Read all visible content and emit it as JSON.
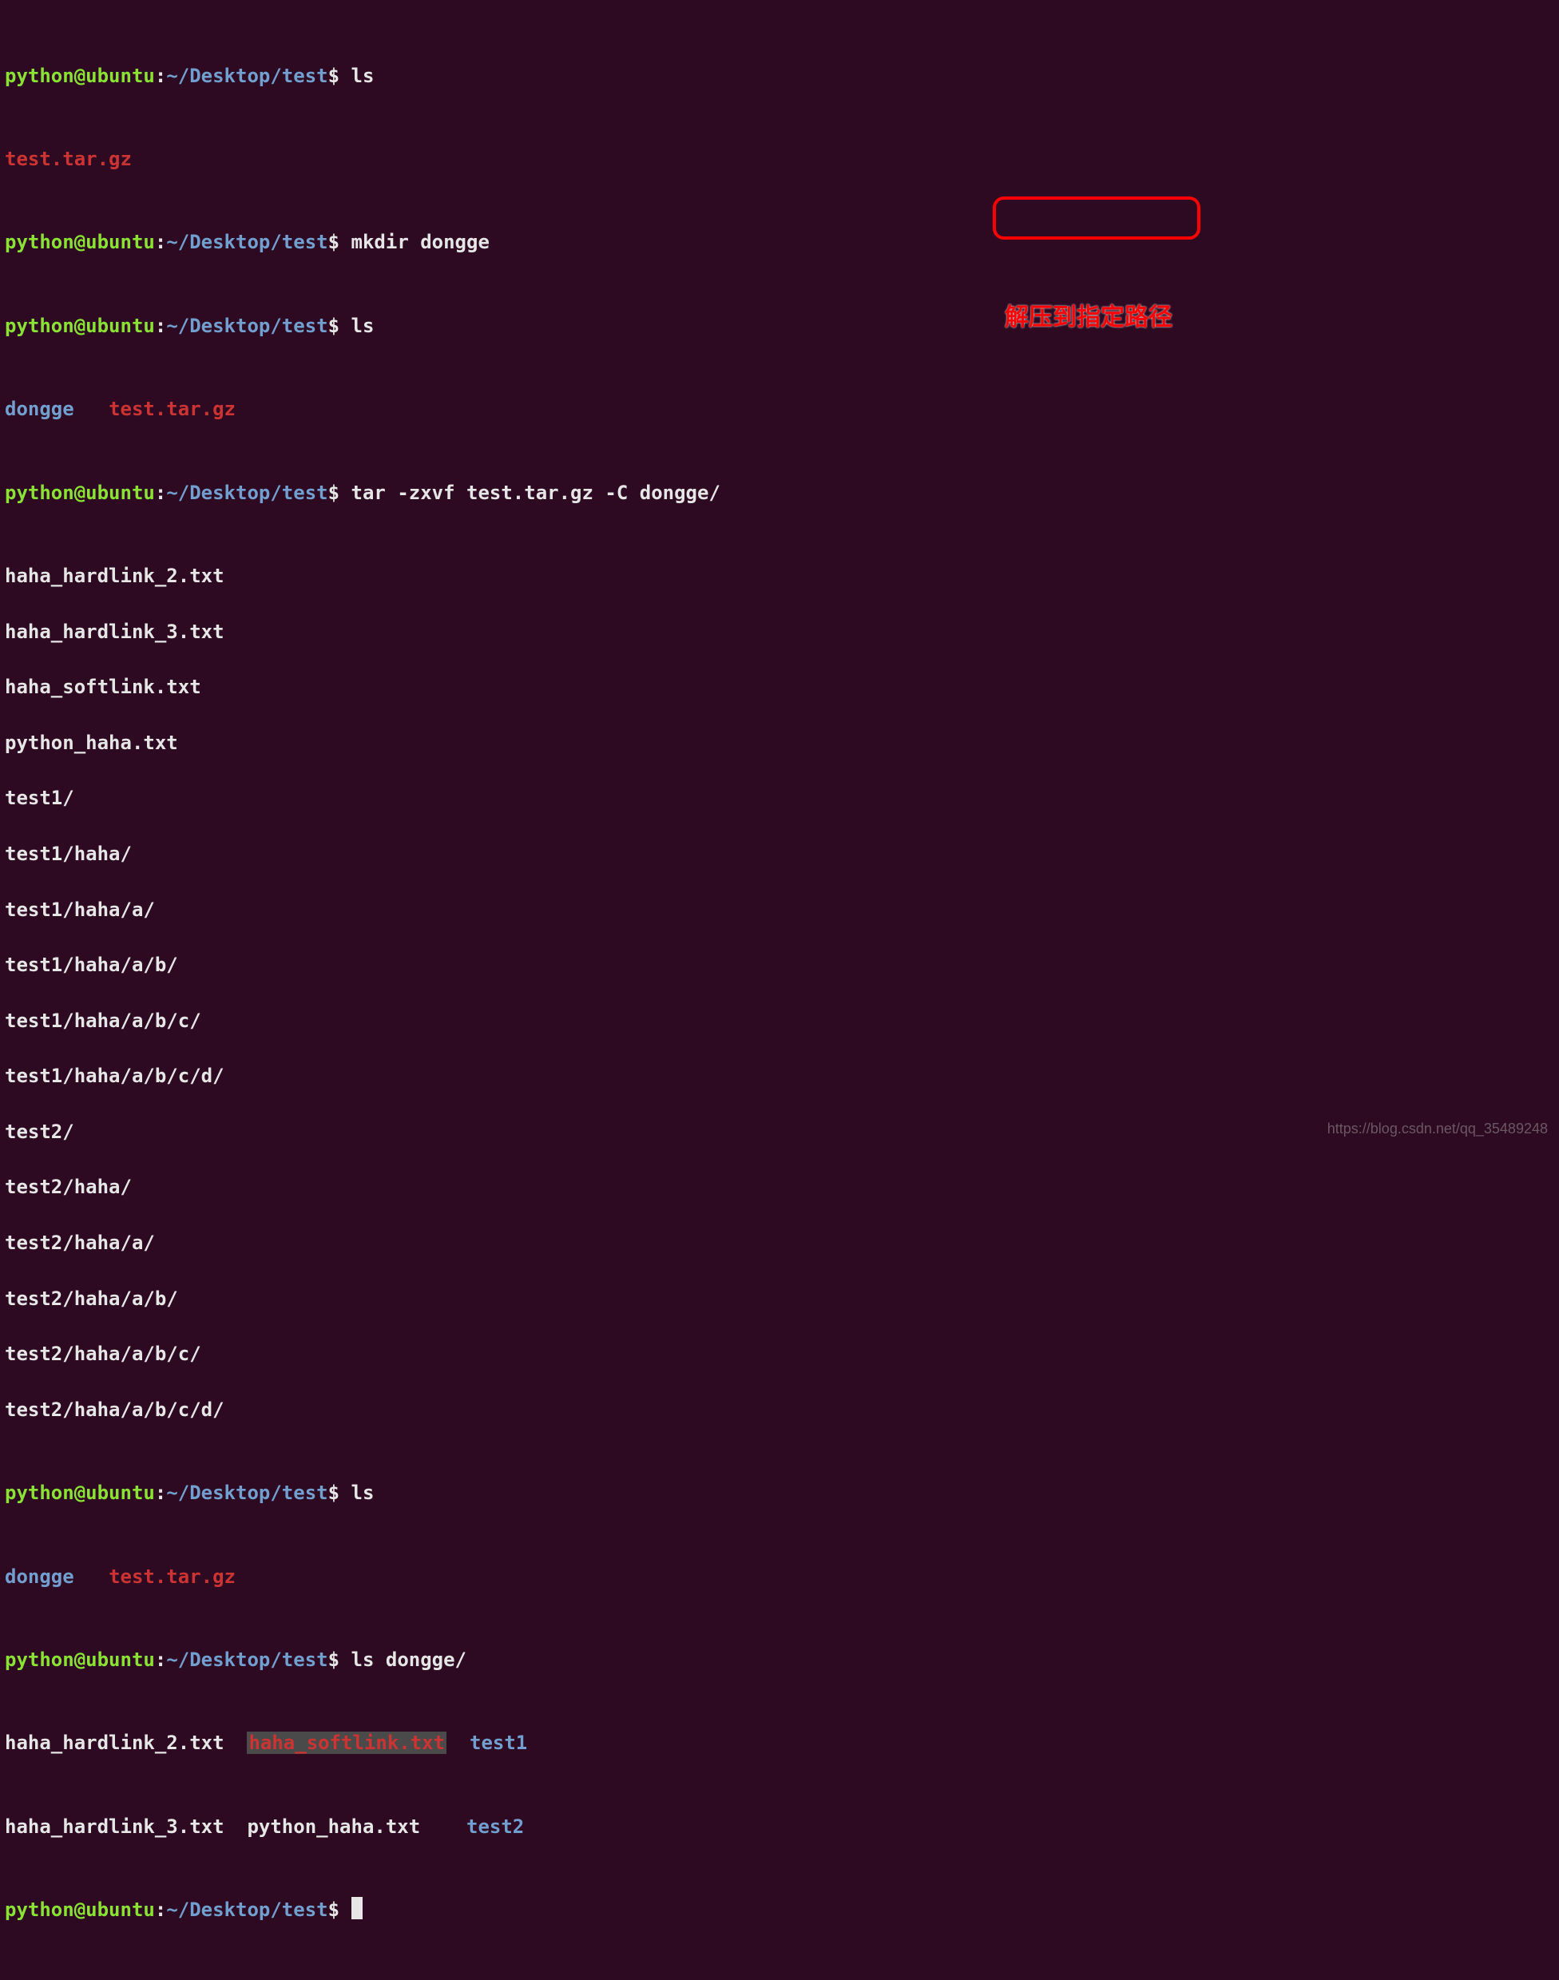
{
  "prompt": {
    "user": "python",
    "host": "ubuntu",
    "path": "~/Desktop/test",
    "sym": "$"
  },
  "cmds": {
    "ls": "ls",
    "mkdir": "mkdir dongge",
    "tar_prefix": "tar -zxvf test.tar.gz ",
    "tar_suffix": "-C dongge/",
    "ls_dir": "ls dongge/"
  },
  "outputs": {
    "file_archive": "test.tar.gz",
    "dir_dongge": "dongge",
    "tar_list": [
      "haha_hardlink_2.txt",
      "haha_hardlink_3.txt",
      "haha_softlink.txt",
      "python_haha.txt",
      "test1/",
      "test1/haha/",
      "test1/haha/a/",
      "test1/haha/a/b/",
      "test1/haha/a/b/c/",
      "test1/haha/a/b/c/d/",
      "test2/",
      "test2/haha/",
      "test2/haha/a/",
      "test2/haha/a/b/",
      "test2/haha/a/b/c/",
      "test2/haha/a/b/c/d/"
    ],
    "ls2_row1": {
      "c1": "haha_hardlink_2.txt",
      "c2": "haha_softlink.txt",
      "c3": "test1"
    },
    "ls2_row2": {
      "c1": "haha_hardlink_3.txt",
      "c2": "python_haha.txt",
      "c3": "test2"
    }
  },
  "annotation": {
    "text": "解压到指定路径"
  },
  "watermark": "https://blog.csdn.net/qq_35489248"
}
